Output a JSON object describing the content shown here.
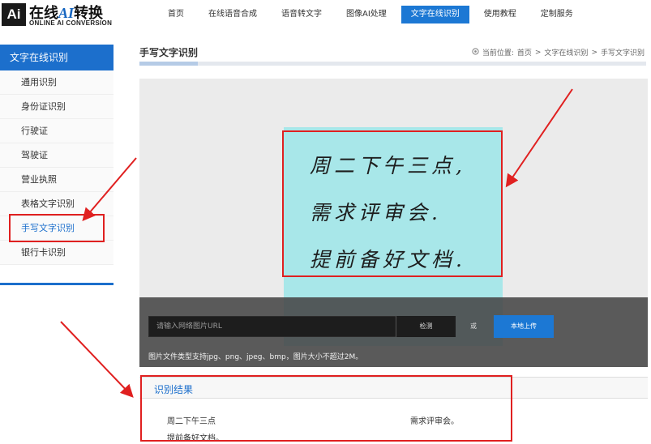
{
  "logo": {
    "box": "Ai",
    "title_prefix": "在线",
    "title_ai": "AI",
    "title_suffix": "转换",
    "subtitle": "ONLINE AI CONVERSION"
  },
  "nav": [
    {
      "label": "首页"
    },
    {
      "label": "在线语音合成"
    },
    {
      "label": "语音转文字"
    },
    {
      "label": "图像AI处理"
    },
    {
      "label": "文字在线识别",
      "active": true
    },
    {
      "label": "使用教程"
    },
    {
      "label": "定制服务"
    }
  ],
  "sidebar": {
    "title": "文字在线识别",
    "items": [
      {
        "label": "通用识别"
      },
      {
        "label": "身份证识别"
      },
      {
        "label": "行驶证"
      },
      {
        "label": "驾驶证"
      },
      {
        "label": "营业执照"
      },
      {
        "label": "表格文字识别"
      },
      {
        "label": "手写文字识别",
        "active": true
      },
      {
        "label": "银行卡识别"
      }
    ]
  },
  "main": {
    "title": "手写文字识别",
    "breadcrumb": {
      "prefix": "当前位置:",
      "items": [
        "首页",
        "文字在线识别",
        "手写文字识别"
      ],
      "separator": ">"
    }
  },
  "image_text": [
    "周二下午三点,",
    "需求评审会.",
    "提前备好文档."
  ],
  "upload": {
    "url_placeholder": "请输入网络图片URL",
    "detect_label": "检测",
    "or_label": "或",
    "local_upload_label": "本地上传",
    "hint": "图片文件类型支持jpg、png、jpeg、bmp，图片大小不超过2M。"
  },
  "result": {
    "title": "识别结果",
    "lines": [
      "周二下午三点",
      "需求评审会。",
      "提前备好文档。"
    ]
  },
  "colors": {
    "accent": "#1c78d4",
    "sidebar_accent": "#1c6fcc",
    "note": "#a8e7e9",
    "annotation": "#e02020"
  },
  "icons": {
    "breadcrumb": "location-icon"
  }
}
